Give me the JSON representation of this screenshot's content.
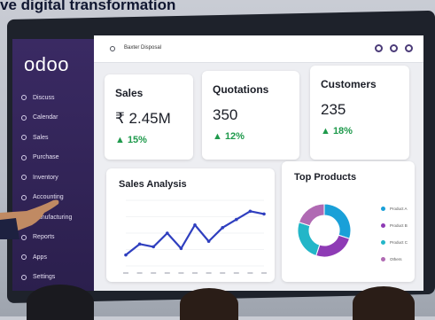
{
  "headline": "ve digital transformation",
  "app": {
    "logo": "odoo"
  },
  "topbar": {
    "workspace": "Baxter Disposal"
  },
  "sidebar": {
    "items": [
      {
        "label": "Discuss"
      },
      {
        "label": "Calendar"
      },
      {
        "label": "Sales"
      },
      {
        "label": "Purchase"
      },
      {
        "label": "Inventory"
      },
      {
        "label": "Accounting"
      },
      {
        "label": "Manufacturing"
      },
      {
        "label": "Reports"
      },
      {
        "label": "Apps"
      },
      {
        "label": "Settings"
      }
    ]
  },
  "kpis": {
    "sales": {
      "label": "Sales",
      "value": "₹ 2.45M",
      "delta": "▲ 15%"
    },
    "quotations": {
      "label": "Quotations",
      "value": "350",
      "delta": "▲ 12%"
    },
    "customers": {
      "label": "Customers",
      "value": "235",
      "delta": "▲ 18%"
    }
  },
  "colors": {
    "sidebar": "#3a2a63",
    "accent": "#5a3f9b",
    "positive": "#1f9a4c",
    "line": "#2f3fbf"
  },
  "chart_data": [
    {
      "type": "line",
      "title": "Sales Analysis",
      "x": [
        "",
        "",
        "",
        "",
        "",
        "",
        "",
        "",
        "",
        "",
        ""
      ],
      "series": [
        {
          "values": [
            2,
            4,
            3.5,
            6,
            3.2,
            7.5,
            4.5,
            7,
            8.5,
            10,
            9.5
          ]
        }
      ],
      "ylim": [
        0,
        12
      ],
      "grid": true
    },
    {
      "type": "pie",
      "title": "Top Products",
      "categories": [
        "Product A",
        "Product B",
        "Product C",
        "Others"
      ],
      "values": [
        30,
        25,
        25,
        20
      ],
      "colors": [
        "#1aa0d8",
        "#8e3bb5",
        "#23b6c8",
        "#b06ab3"
      ]
    }
  ]
}
